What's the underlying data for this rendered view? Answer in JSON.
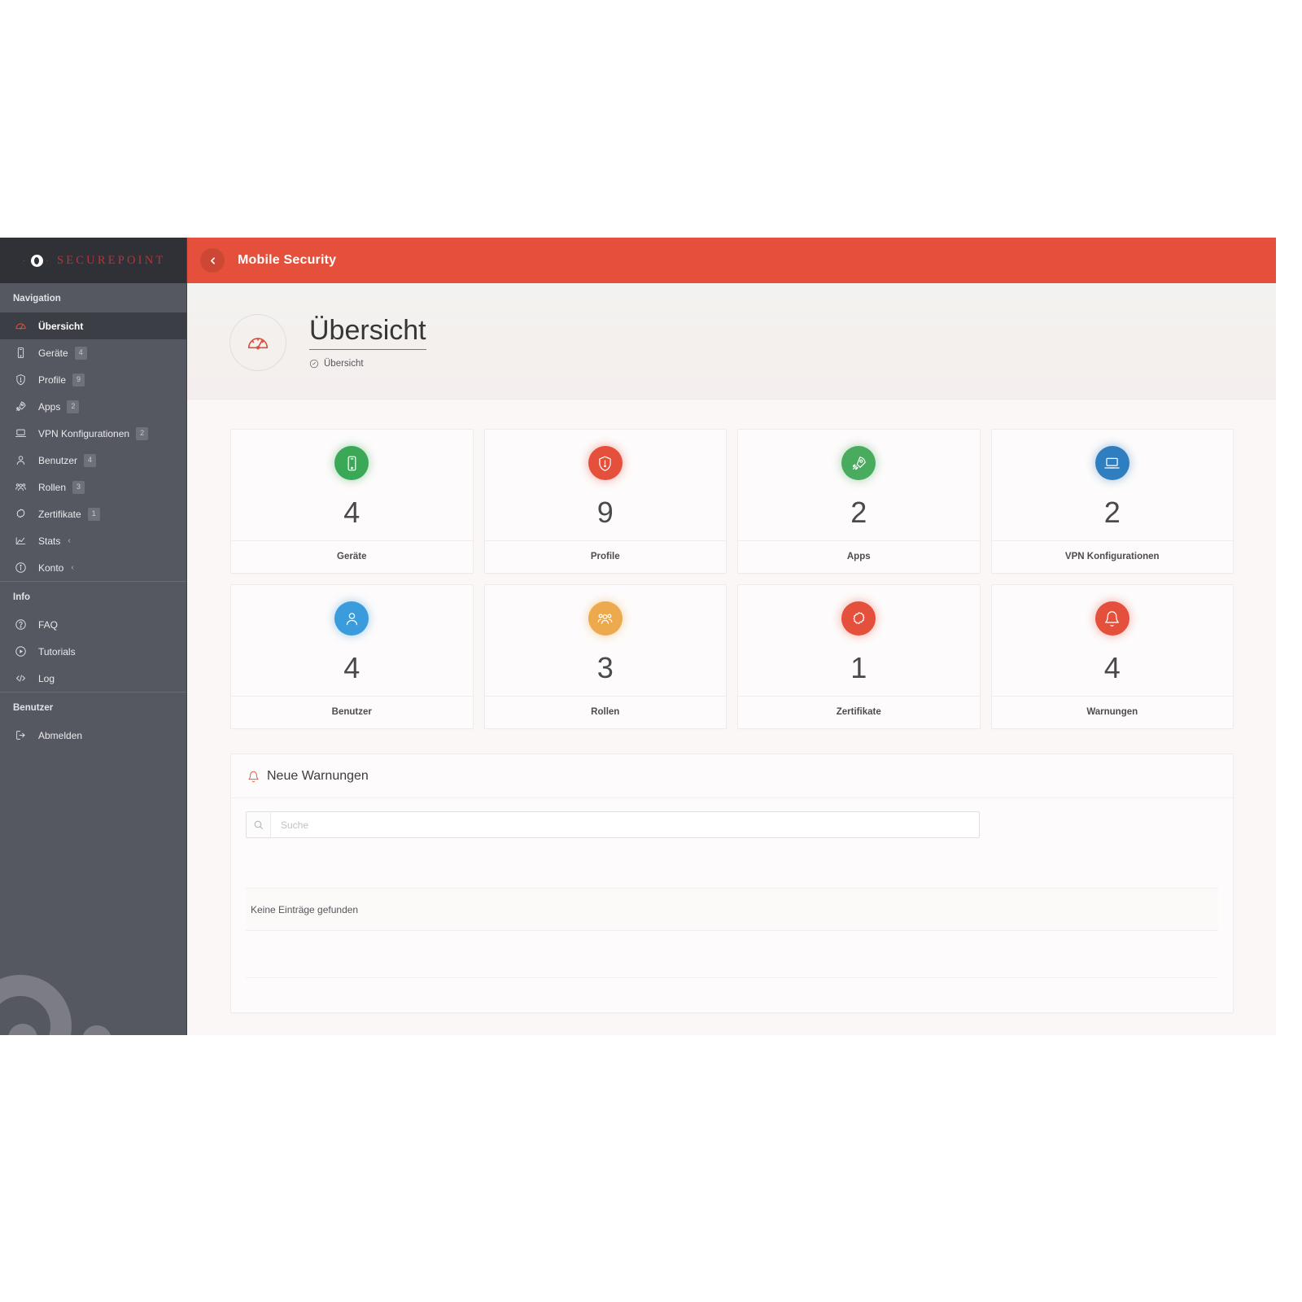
{
  "colors": {
    "accent": "#e5503c",
    "sidebar_bg": "#565861",
    "sidebar_logo_bg": "#2f3137",
    "green": "#3aa856",
    "red": "#e5503c",
    "blue": "#2f82c4",
    "light_blue": "#3a9cdd",
    "orange": "#eda94d",
    "brand_text": "#b4353a"
  },
  "sidebar": {
    "logo": {
      "text": "SECUREPOINT",
      "dot": "·",
      "icon": "securepoint-o-logo"
    },
    "sections": [
      {
        "title": "Navigation",
        "items": [
          {
            "label": "Übersicht",
            "icon": "dashboard-gauge-icon",
            "badge": "",
            "caret": "",
            "active": true
          },
          {
            "label": "Geräte",
            "icon": "mobile-device-icon",
            "badge": "4",
            "caret": "",
            "active": false
          },
          {
            "label": "Profile",
            "icon": "shield-icon",
            "badge": "9",
            "caret": "",
            "active": false
          },
          {
            "label": "Apps",
            "icon": "rocket-icon",
            "badge": "2",
            "caret": "",
            "active": false
          },
          {
            "label": "VPN Konfigurationen",
            "icon": "laptop-icon",
            "badge": "2",
            "caret": "",
            "active": false
          },
          {
            "label": "Benutzer",
            "icon": "user-icon",
            "badge": "4",
            "caret": "",
            "active": false
          },
          {
            "label": "Rollen",
            "icon": "users-group-icon",
            "badge": "3",
            "caret": "",
            "active": false
          },
          {
            "label": "Zertifikate",
            "icon": "certificate-seal-icon",
            "badge": "1",
            "caret": "",
            "active": false
          },
          {
            "label": "Stats",
            "icon": "chart-icon",
            "badge": "",
            "caret": "‹",
            "active": false
          },
          {
            "label": "Konto",
            "icon": "info-circle-icon",
            "badge": "",
            "caret": "‹",
            "active": false
          }
        ]
      },
      {
        "title": "Info",
        "items": [
          {
            "label": "FAQ",
            "icon": "question-circle-icon",
            "badge": "",
            "caret": "",
            "active": false
          },
          {
            "label": "Tutorials",
            "icon": "play-circle-icon",
            "badge": "",
            "caret": "",
            "active": false
          },
          {
            "label": "Log",
            "icon": "code-icon",
            "badge": "",
            "caret": "",
            "active": false
          }
        ]
      },
      {
        "title": "Benutzer",
        "items": [
          {
            "label": "Abmelden",
            "icon": "logout-icon",
            "badge": "",
            "caret": "",
            "active": false
          }
        ]
      }
    ]
  },
  "topbar": {
    "back_icon": "chevron-left-icon",
    "title": "Mobile Security"
  },
  "pagehead": {
    "icon": "dashboard-gauge-icon",
    "title": "Übersicht",
    "breadcrumb_icon": "dashboard-gauge-icon",
    "breadcrumb": "Übersicht"
  },
  "cards": [
    {
      "value": "4",
      "label": "Geräte",
      "icon": "mobile-device-icon",
      "color": "#3aa856"
    },
    {
      "value": "9",
      "label": "Profile",
      "icon": "shield-icon",
      "color": "#e5503c"
    },
    {
      "value": "2",
      "label": "Apps",
      "icon": "rocket-icon",
      "color": "#49ab5e"
    },
    {
      "value": "2",
      "label": "VPN Konfigurationen",
      "icon": "laptop-icon",
      "color": "#2f7fc0"
    },
    {
      "value": "4",
      "label": "Benutzer",
      "icon": "user-icon",
      "color": "#3a9cdd"
    },
    {
      "value": "3",
      "label": "Rollen",
      "icon": "users-group-icon",
      "color": "#eda94d"
    },
    {
      "value": "1",
      "label": "Zertifikate",
      "icon": "certificate-seal-icon",
      "color": "#e5503c"
    },
    {
      "value": "4",
      "label": "Warnungen",
      "icon": "bell-icon",
      "color": "#e5503c"
    }
  ],
  "warnings_panel": {
    "icon": "bell-icon",
    "title": "Neue Warnungen",
    "search": {
      "icon": "search-icon",
      "placeholder": "Suche",
      "value": ""
    },
    "empty_text": "Keine Einträge gefunden",
    "rows": []
  }
}
